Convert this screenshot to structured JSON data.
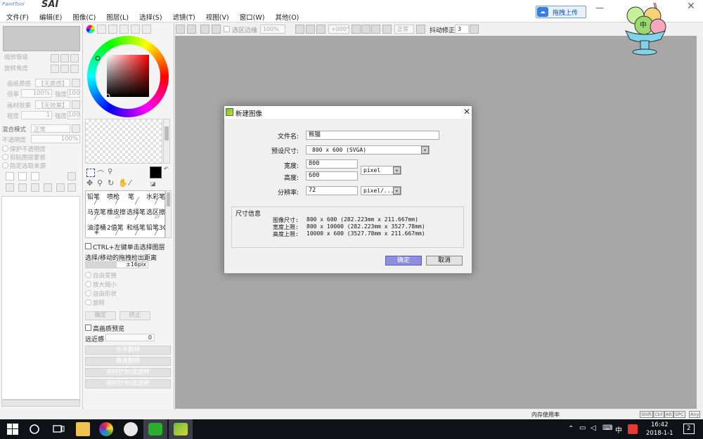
{
  "app": {
    "brand_small": "PaintTool",
    "brand_large": "SAI"
  },
  "menu": [
    "文件(F)",
    "编辑(E)",
    "图像(C)",
    "图层(L)",
    "选择(S)",
    "滤镜(T)",
    "视图(V)",
    "窗口(W)",
    "其他(O)"
  ],
  "top_right": {
    "upload_label": "拖拽上传",
    "mascot_text": "中"
  },
  "toolbar": {
    "select_edge": "选区边缘",
    "zoom": "100%",
    "angle": "+000°",
    "mode": "正常",
    "stabilizer_label": "抖动修正",
    "stabilizer_value": "3"
  },
  "left_panel": {
    "zoom_label": "缩放等级",
    "rotate_label": "旋转角度",
    "paper_texture": "画纸质感",
    "paper_texture_value": "【无质感】",
    "magnify": "倍率",
    "magnify_value": "100%",
    "strength": "强度",
    "strength_value": "100",
    "paper_effect": "画材效果",
    "paper_effect_value": "【无效果】",
    "width": "程度",
    "width_value": "1",
    "strength2_value": "100",
    "blend_mode": "混合模式",
    "blend_mode_value": "正常",
    "opacity": "不透明度",
    "opacity_value": "100%",
    "protect_opacity": "保护不透明度",
    "clip_group": "剪贴图层蒙板",
    "selection_source": "指定选取来源"
  },
  "tool_panel": {
    "brush_tools": [
      [
        "铅笔",
        "喷枪",
        "笔",
        "水彩笔"
      ],
      [
        "马克笔",
        "橡皮擦",
        "选择笔",
        "选区擦"
      ],
      [
        "油漆桶",
        "2值笔",
        "和纸笔",
        "铅笔30"
      ]
    ],
    "ctrl_alt_label": "CTRL+左键单击选择图层",
    "drag_label": "选择/移动的拖拽检出距离",
    "drag_value": "±16pix",
    "transforms": [
      "自由变换",
      "放大缩小",
      "自由形状",
      "旋转"
    ],
    "ok_label": "确定",
    "cancel_label": "终止",
    "hq_preview": "高画质预览",
    "perspective_label": "远近感",
    "perspective_value": "0",
    "flip_buttons": [
      "水平翻转",
      "垂直翻转",
      "逆时针90度旋转",
      "顺时针90度旋转"
    ]
  },
  "dialog": {
    "title": "新建图像",
    "filename_label": "文件名:",
    "filename_value": "熊猫",
    "preset_label": "预设尺寸:",
    "preset_value": "800 x  600 (SVGA)",
    "width_label": "宽度:",
    "width_value": "800",
    "height_label": "高度:",
    "height_value": "600",
    "unit_value": "pixel",
    "resolution_label": "分辨率:",
    "resolution_value": "72",
    "resolution_unit": "pixel/...",
    "size_info_title": "尺寸信息",
    "info_lines": [
      [
        "图像尺寸:",
        "800 x 600 (282.223mm x 211.667mm)"
      ],
      [
        "宽度上限:",
        "800 x 10000 (282.223mm x 3527.78mm)"
      ],
      [
        "高度上限:",
        "10000 x 600 (3527.78mm x 211.667mm)"
      ]
    ],
    "ok_label": "确定",
    "cancel_label": "取消"
  },
  "statusbar": {
    "memory_text": "内存使用率",
    "kbd_items": [
      "Shift",
      "Ctrl",
      "Alt",
      "SPC",
      "Any"
    ]
  },
  "taskbar": {
    "ime": "中",
    "time": "16:42",
    "date": "2018-1-1",
    "notifications": "2"
  },
  "colors": {
    "canvas": "#a7a7a7",
    "accent": "#8e8ede"
  }
}
